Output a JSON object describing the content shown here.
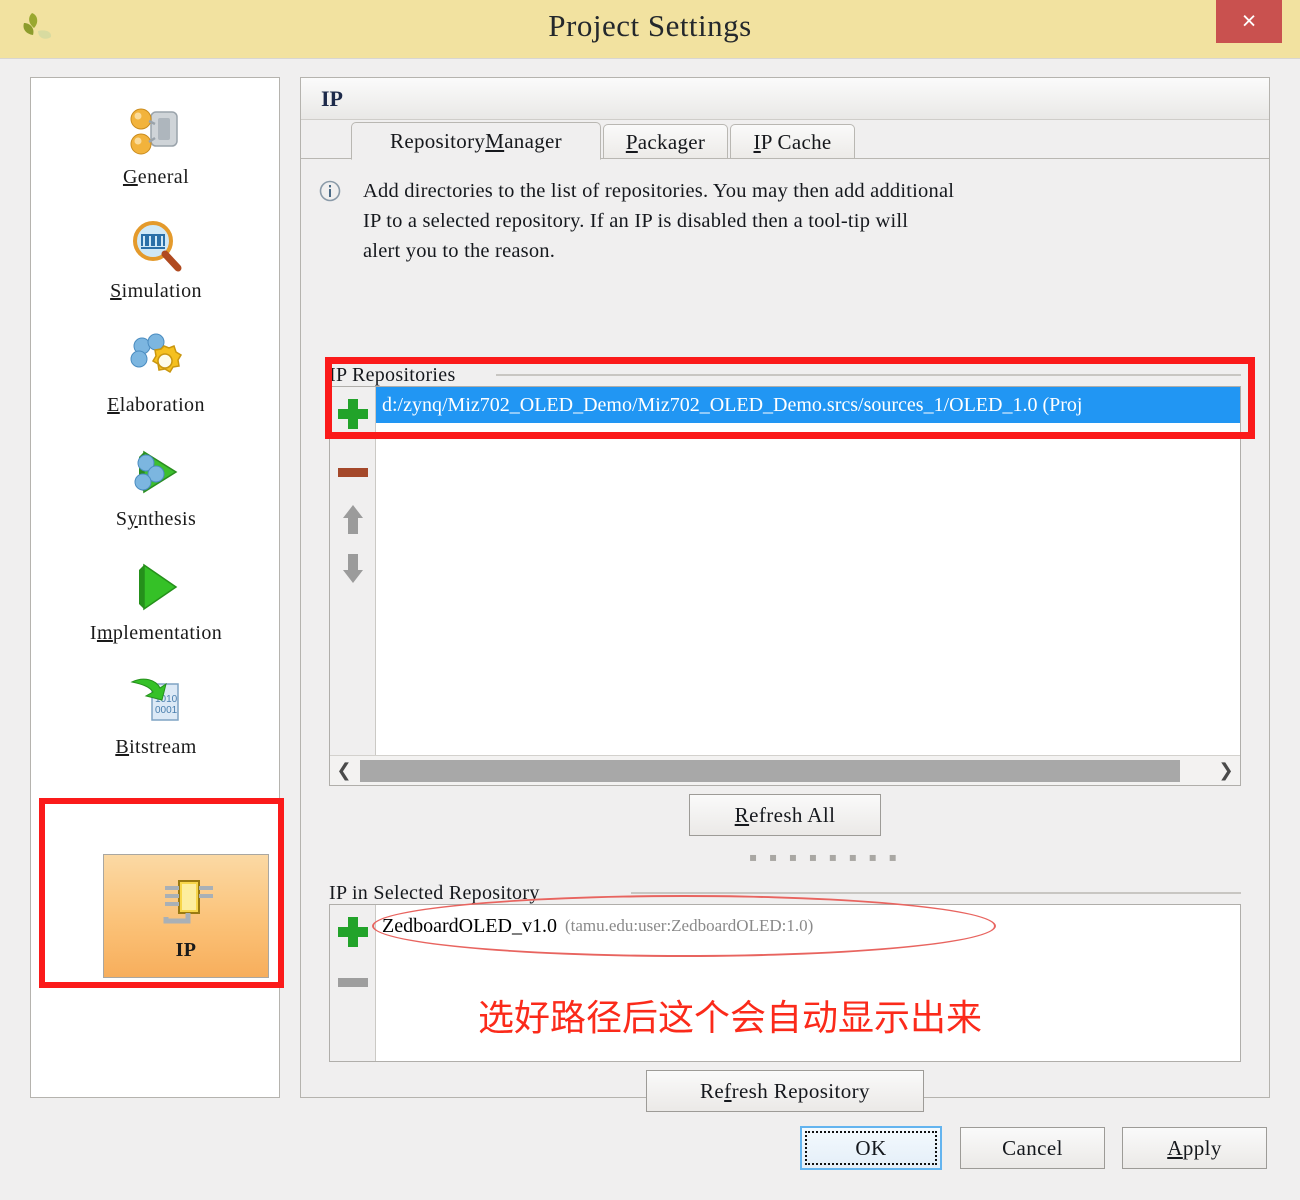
{
  "window": {
    "title": "Project Settings",
    "logo_icon": "vivado-leaf-logo-icon",
    "close_label": "×"
  },
  "sidebar": {
    "items": [
      {
        "label_pre": "",
        "label_mnemonic": "G",
        "label_post": "eneral",
        "icon": "general-icon"
      },
      {
        "label_pre": "",
        "label_mnemonic": "S",
        "label_post": "imulation",
        "icon": "simulation-magnifier-icon"
      },
      {
        "label_pre": "",
        "label_mnemonic": "E",
        "label_post": "laboration",
        "icon": "elaboration-gear-icon"
      },
      {
        "label_pre": "S",
        "label_mnemonic": "y",
        "label_post": "nthesis",
        "icon": "synthesis-arrow-icon"
      },
      {
        "label_pre": "I",
        "label_mnemonic": "m",
        "label_post": "plementation",
        "icon": "implementation-play-icon"
      },
      {
        "label_pre": "",
        "label_mnemonic": "B",
        "label_post": "itstream",
        "icon": "bitstream-file-icon"
      }
    ],
    "selected": {
      "label": "IP",
      "icon": "ip-chip-icon"
    }
  },
  "panel": {
    "header_title": "IP",
    "tabs": [
      {
        "pre": "Repository ",
        "mnemonic": "M",
        "post": "anager",
        "active": true
      },
      {
        "pre": "",
        "mnemonic": "P",
        "post": "ackager",
        "active": false
      },
      {
        "pre": "",
        "mnemonic": "I",
        "post": "P Cache",
        "active": false
      }
    ],
    "info_icon": "info-circle-icon",
    "info_text": "Add directories to the list of repositories. You may then add additional\nIP to a selected repository. If an IP is disabled then a tool-tip will\nalert you to the reason."
  },
  "ip_repositories": {
    "group_label": "IP Repositories",
    "add_icon": "plus-icon",
    "remove_icon": "minus-icon",
    "move_up_icon": "arrow-up-icon",
    "move_down_icon": "arrow-down-icon",
    "rows": [
      "d:/zynq/Miz702_OLED_Demo/Miz702_OLED_Demo.srcs/sources_1/OLED_1.0 (Proj"
    ],
    "scroll_left_icon": "chevron-left-icon",
    "scroll_right_icon": "chevron-right-icon",
    "refresh_all": {
      "pre": "",
      "mnemonic": "R",
      "post": "efresh All"
    },
    "splitter_dots": "▪ ▪ ▪ ▪ ▪ ▪ ▪ ▪"
  },
  "ip_in_selected_repository": {
    "group_label": "IP in Selected Repository",
    "add_icon": "plus-icon",
    "remove_icon": "minus-icon",
    "rows": [
      {
        "name": "ZedboardOLED_v1.0",
        "vlnv": "(tamu.edu:user:ZedboardOLED:1.0)"
      }
    ],
    "refresh_repository": {
      "pre": "Re",
      "mnemonic": "f",
      "post": "resh Repository"
    }
  },
  "footer": {
    "ok": {
      "pre": "",
      "mnemonic": "",
      "post": "OK"
    },
    "cancel": {
      "pre": "",
      "mnemonic": "",
      "post": "Cancel"
    },
    "apply": {
      "pre": "",
      "mnemonic": "A",
      "post": "pply"
    }
  },
  "annotations": {
    "chinese_note": "选好路径后这个会自动显示出来",
    "box_color": "#fb1a1a",
    "ellipse_color": "#e8645f",
    "note_color": "#fb2a1a"
  }
}
